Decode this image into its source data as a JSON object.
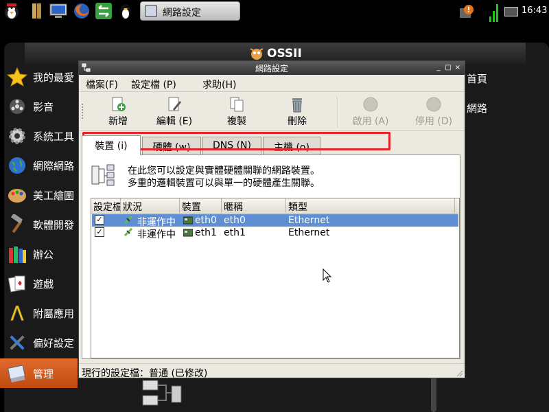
{
  "taskbar": {
    "task_label": "網路設定",
    "clock": "16:43"
  },
  "menu": {
    "brand": "OSSII",
    "sidebar_items": [
      {
        "label": "我的最愛"
      },
      {
        "label": "影音"
      },
      {
        "label": "系統工具"
      },
      {
        "label": "網際網路"
      },
      {
        "label": "美工繪圖"
      },
      {
        "label": "軟體開發"
      },
      {
        "label": "辦公"
      },
      {
        "label": "遊戲"
      },
      {
        "label": "附屬應用"
      },
      {
        "label": "偏好設定"
      },
      {
        "label": "管理"
      }
    ],
    "right_items": [
      {
        "label": "首頁"
      },
      {
        "label": "網路"
      }
    ]
  },
  "dialog": {
    "title": "網路設定",
    "window_buttons": {
      "minimize": "_",
      "maximize": "□",
      "close": "×"
    },
    "menus": [
      "檔案(F)",
      "設定檔 (P)",
      "求助(H)"
    ],
    "toolbar": [
      {
        "label": "新增",
        "icon": "new-icon",
        "enabled": true
      },
      {
        "label": "編輯 (E)",
        "icon": "edit-icon",
        "enabled": true
      },
      {
        "label": "複製",
        "icon": "copy-icon",
        "enabled": true
      },
      {
        "label": "刪除",
        "icon": "delete-icon",
        "enabled": true
      },
      {
        "label": "啟用 (A)",
        "icon": "activate-icon",
        "enabled": false
      },
      {
        "label": "停用 (D)",
        "icon": "deactivate-icon",
        "enabled": false
      }
    ],
    "tabs": [
      {
        "label": "裝置 (i)",
        "active": true
      },
      {
        "label": "硬體 (w)",
        "active": false
      },
      {
        "label": "DNS (N)",
        "active": false
      },
      {
        "label": "主機 (o)",
        "active": false
      }
    ],
    "info": {
      "line1": "在此您可以設定與實體硬體關聯的網路裝置。",
      "line2": "多重的邏輯裝置可以與單一的硬體產生關聯。"
    },
    "table": {
      "columns": [
        "設定檔",
        "狀況",
        "裝置",
        "暱稱",
        "類型"
      ],
      "rows": [
        {
          "enabled": true,
          "status": "非運作中",
          "device": "eth0",
          "nickname": "eth0",
          "type": "Ethernet",
          "selected": true
        },
        {
          "enabled": true,
          "status": "非運作中",
          "device": "eth1",
          "nickname": "eth1",
          "type": "Ethernet",
          "selected": false
        }
      ]
    },
    "status_bar": "現行的設定檔：普通 (已修改)"
  },
  "colors": {
    "highlight_box": "#e3242b",
    "selection": "#5e8ed4",
    "active_menu": "#e06b2c"
  }
}
